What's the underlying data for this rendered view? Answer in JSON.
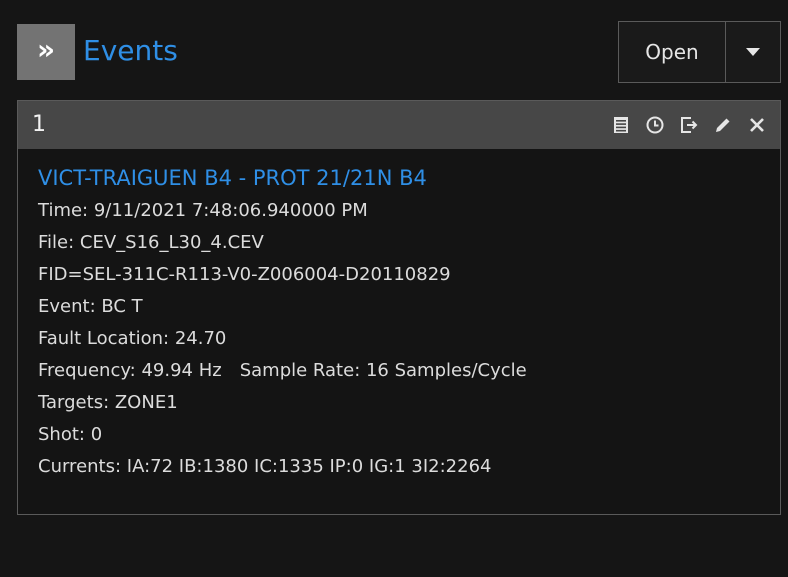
{
  "header": {
    "expand_glyph": "»",
    "title": "Events",
    "open_label": "Open"
  },
  "card": {
    "number": "1",
    "event_title": "VICT-TRAIGUEN B4 - PROT 21/21N B4",
    "time": "Time:  9/11/2021 7:48:06.940000 PM",
    "file": "File: CEV_S16_L30_4.CEV",
    "fid": "FID=SEL-311C-R113-V0-Z006004-D20110829",
    "event": "Event: BC T",
    "fault_location": "Fault Location: 24.70",
    "frequency": "Frequency: 49.94 Hz",
    "sample_rate": "Sample Rate: 16 Samples/Cycle",
    "targets": "Targets: ZONE1",
    "shot": "Shot: 0",
    "currents": "Currents: IA:72 IB:1380 IC:1335 IP:0 IG:1 3I2:2264"
  },
  "colors": {
    "accent": "#2f8fe6",
    "header_bar": "#474747",
    "expand_button": "#737373"
  },
  "icons": [
    "expand-icon",
    "chevron-down-icon",
    "report-icon",
    "clock-icon",
    "export-icon",
    "edit-icon",
    "close-icon"
  ]
}
